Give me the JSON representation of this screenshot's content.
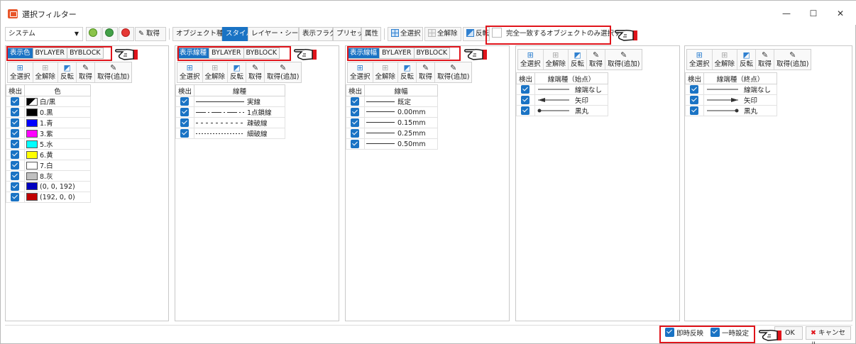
{
  "window": {
    "title": "選択フィルター",
    "minimize": "—",
    "maximize": "☐",
    "close": "✕"
  },
  "toolbar": {
    "system_select": "システム",
    "get": "取得",
    "tabs": [
      "オブジェクト種別",
      "スタイル",
      "レイヤー・シート",
      "表示フラグ",
      "プリセット",
      "属性"
    ],
    "active_tab": "スタイル",
    "select_all": "全選択",
    "deselect_all": "全解除",
    "invert": "反転",
    "exact_match_label": "完全一致するオブジェクトのみ選択する"
  },
  "actions": {
    "select_all": "全選択",
    "deselect_all": "全解除",
    "invert": "反転",
    "get": "取得",
    "get_add": "取得(追加)"
  },
  "panel_color": {
    "display_tabs": [
      "表示色",
      "BYLAYER",
      "BYBLOCK"
    ],
    "headers": [
      "検出",
      "色"
    ],
    "rows": [
      {
        "label": "白/黒",
        "color": "#000000"
      },
      {
        "label": "0.黒",
        "color": "#000000"
      },
      {
        "label": "1.青",
        "color": "#0000ff"
      },
      {
        "label": "3.紫",
        "color": "#ff00ff"
      },
      {
        "label": "5.水",
        "color": "#00ffff"
      },
      {
        "label": "6.黄",
        "color": "#ffff00"
      },
      {
        "label": "7.白",
        "color": "#ffffff"
      },
      {
        "label": "8.灰",
        "color": "#c0c0c0"
      },
      {
        "label": "(0, 0, 192)",
        "color": "#0000c0"
      },
      {
        "label": "(192, 0, 0)",
        "color": "#c00000"
      }
    ]
  },
  "panel_linetype": {
    "display_tabs": [
      "表示線種",
      "BYLAYER",
      "BYBLOCK"
    ],
    "headers": [
      "検出",
      "線種"
    ],
    "rows": [
      {
        "label": "実線",
        "style": "solid"
      },
      {
        "label": "1点鎖線",
        "style": "dashdot"
      },
      {
        "label": "疎破線",
        "style": "sparse"
      },
      {
        "label": "細破線",
        "style": "fine"
      }
    ]
  },
  "panel_lineweight": {
    "display_tabs": [
      "表示線幅",
      "BYLAYER",
      "BYBLOCK"
    ],
    "headers": [
      "検出",
      "線幅"
    ],
    "rows": [
      "既定",
      "0.00mm",
      "0.15mm",
      "0.25mm",
      "0.50mm"
    ]
  },
  "panel_endstart": {
    "headers": [
      "検出",
      "線端種（始点）"
    ],
    "rows": [
      "線端なし",
      "矢印",
      "黒丸"
    ]
  },
  "panel_endend": {
    "headers": [
      "検出",
      "線端種（終点）"
    ],
    "rows": [
      "線端なし",
      "矢印",
      "黒丸"
    ]
  },
  "status": {
    "instant_apply": "即時反映",
    "temp_setting": "一時設定",
    "ok": "OK",
    "cancel": "キャンセル"
  }
}
